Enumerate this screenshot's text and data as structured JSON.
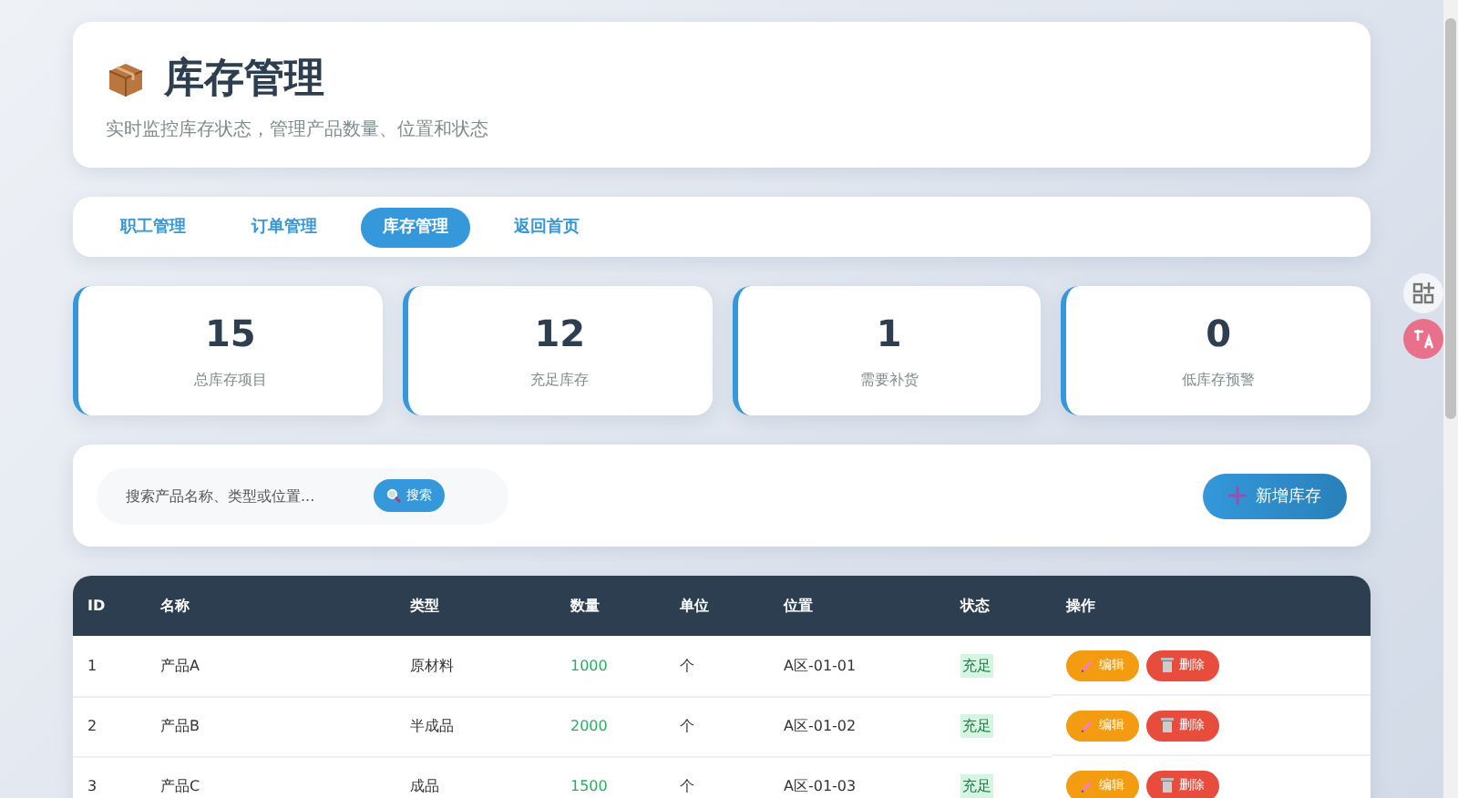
{
  "header": {
    "title": "库存管理",
    "subtitle": "实时监控库存状态，管理产品数量、位置和状态"
  },
  "nav": [
    {
      "label": "职工管理",
      "selected": false
    },
    {
      "label": "订单管理",
      "selected": false
    },
    {
      "label": "库存管理",
      "selected": true
    },
    {
      "label": "返回首页",
      "selected": false
    }
  ],
  "stats": [
    {
      "value": "15",
      "label": "总库存项目"
    },
    {
      "value": "12",
      "label": "充足库存"
    },
    {
      "value": "1",
      "label": "需要补货"
    },
    {
      "value": "0",
      "label": "低库存预警"
    }
  ],
  "search": {
    "placeholder": "搜索产品名称、类型或位置...",
    "button": "搜索"
  },
  "add_button": "新增库存",
  "table": {
    "columns": [
      "ID",
      "名称",
      "类型",
      "数量",
      "单位",
      "位置",
      "状态",
      "操作"
    ],
    "rows": [
      {
        "id": "1",
        "name": "产品A",
        "type": "原材料",
        "quantity": "1000",
        "unit": "个",
        "location": "A区-01-01",
        "status": "充足",
        "actions": [
          "编辑",
          "删除"
        ]
      },
      {
        "id": "2",
        "name": "产品B",
        "type": "半成品",
        "quantity": "2000",
        "unit": "个",
        "location": "A区-01-02",
        "status": "充足",
        "actions": [
          "编辑",
          "删除"
        ]
      },
      {
        "id": "3",
        "name": "产品C",
        "type": "成品",
        "quantity": "1500",
        "unit": "个",
        "location": "A区-01-03",
        "status": "充足",
        "actions": [
          "编辑",
          "删除"
        ]
      }
    ]
  }
}
